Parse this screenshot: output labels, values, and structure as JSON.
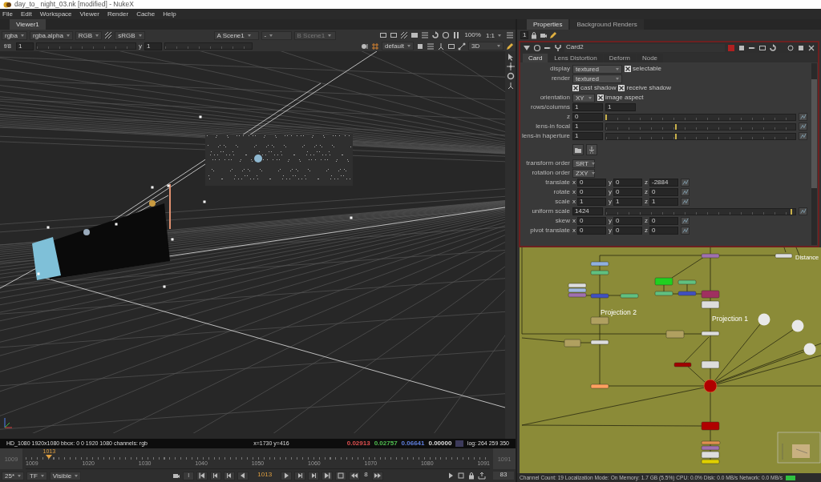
{
  "window": {
    "title": "day_to_ night_03.nk [modified] - NukeX"
  },
  "menu": [
    "File",
    "Edit",
    "Workspace",
    "Viewer",
    "Render",
    "Cache",
    "Help"
  ],
  "viewer": {
    "tab": "Viewer1",
    "toolbar_1": {
      "channels": "rgba",
      "alpha": "rgba.alpha",
      "display": "RGB",
      "lut": "sRGB",
      "input_a_label": "A",
      "input_a": "Scene1",
      "operation": "-",
      "input_b_label": "B",
      "input_b": "Scene1",
      "zoom": "100%",
      "ratio": "1:1"
    },
    "toolbar_2": {
      "fstop": "f/8",
      "gain": "1",
      "gamma_label": "y",
      "gamma": "1",
      "grade": "default",
      "view_mode": "3D"
    },
    "info": {
      "format": "HD_1080 1920x1080  bbox: 0 0 1920 1080 channels: rgb",
      "coords": "x=1730 y=416",
      "samples": [
        {
          "text": "0.02913",
          "color": "#e05050"
        },
        {
          "text": "0.02757",
          "color": "#50c050"
        },
        {
          "text": "0.06641",
          "color": "#6080e0"
        },
        {
          "text": "0.00000",
          "color": "#dddddd"
        }
      ],
      "log": "log: 264 259 350"
    },
    "timeline": {
      "start": "1009",
      "end": "1091",
      "marker": "1013",
      "ticks": [
        "1009",
        "1020",
        "1030",
        "1040",
        "1050",
        "1060",
        "1070",
        "1080",
        "1091"
      ]
    },
    "playback": {
      "fps": "25*",
      "timecode": "TF",
      "visibility": "Visible",
      "in_label": "I",
      "frame": "1013",
      "increment": "8",
      "count": "83"
    }
  },
  "properties": {
    "tabs": [
      {
        "label": "Properties",
        "selected": true
      },
      {
        "label": "Background Renders",
        "selected": false
      }
    ],
    "panel_count": "1",
    "node_name": "Card2",
    "node_tabs": [
      {
        "label": "Card",
        "selected": true
      },
      {
        "label": "Lens Distortion",
        "selected": false
      },
      {
        "label": "Deform",
        "selected": false
      },
      {
        "label": "Node",
        "selected": false
      }
    ],
    "rows": [
      {
        "kind": "dropdown",
        "label": "display",
        "value": "textured",
        "check": {
          "label": "selectable",
          "checked": true
        }
      },
      {
        "kind": "dropdown",
        "label": "render",
        "value": "textured"
      },
      {
        "kind": "checks",
        "items": [
          {
            "label": "cast shadow",
            "checked": true
          },
          {
            "label": "receive shadow",
            "checked": true
          }
        ]
      },
      {
        "kind": "dropdown",
        "label": "orientation",
        "value": "XY",
        "check": {
          "label": "image aspect",
          "checked": true
        }
      },
      {
        "kind": "pair",
        "label": "rows/columns",
        "values": [
          "1",
          "1"
        ]
      },
      {
        "kind": "slider",
        "label": "z",
        "value": "0",
        "level": 0.0
      },
      {
        "kind": "slider",
        "label": "lens-in focal",
        "value": "1",
        "level": 0.37
      },
      {
        "kind": "slider",
        "label": "lens-in haperture",
        "value": "1",
        "level": 0.37
      },
      {
        "kind": "icons"
      },
      {
        "kind": "dropdown",
        "label": "transform order",
        "value": "SRT"
      },
      {
        "kind": "dropdown",
        "label": "rotation order",
        "value": "ZXY"
      },
      {
        "kind": "xyz",
        "label": "translate",
        "axes": [
          {
            "axis": "x",
            "value": "0"
          },
          {
            "axis": "y",
            "value": "0"
          },
          {
            "axis": "z",
            "value": "-2884"
          }
        ]
      },
      {
        "kind": "xyz",
        "label": "rotate",
        "axes": [
          {
            "axis": "x",
            "value": "0"
          },
          {
            "axis": "y",
            "value": "0"
          },
          {
            "axis": "z",
            "value": "0"
          }
        ]
      },
      {
        "kind": "xyz",
        "label": "scale",
        "axes": [
          {
            "axis": "x",
            "value": "1"
          },
          {
            "axis": "y",
            "value": "1"
          },
          {
            "axis": "z",
            "value": "1"
          }
        ]
      },
      {
        "kind": "slider",
        "label": "uniform scale",
        "value": "1424",
        "level": 0.98
      },
      {
        "kind": "xyz",
        "label": "skew",
        "axes": [
          {
            "axis": "x",
            "value": "0"
          },
          {
            "axis": "y",
            "value": "0"
          },
          {
            "axis": "z",
            "value": "0"
          }
        ]
      },
      {
        "kind": "xyz",
        "label": "pivot translate",
        "axes": [
          {
            "axis": "x",
            "value": "0"
          },
          {
            "axis": "y",
            "value": "0"
          },
          {
            "axis": "z",
            "value": "0"
          }
        ]
      }
    ]
  },
  "node_graph": {
    "labels": [
      "Projection 2",
      "Projection 1",
      "Distance"
    ]
  },
  "status_bar": "Channel Count: 19  Localization Mode: On  Memory: 1.7 GB (5.5%)  CPU: 0.0%  Disk: 0.0 MB/s  Network: 0.0 MB/s"
}
